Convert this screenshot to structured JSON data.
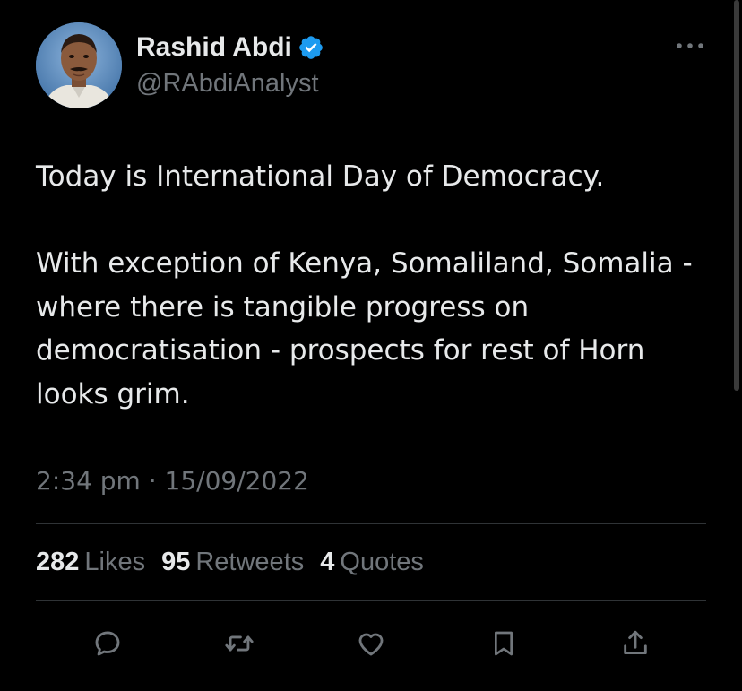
{
  "author": {
    "name": "Rashid Abdi",
    "handle": "@RAbdiAnalyst",
    "verified": true,
    "verified_color": "#1d9bf0"
  },
  "tweet": {
    "paragraphs": [
      "Today is International Day of Democracy.",
      "With exception of Kenya, Somaliland, Somalia - where there is tangible progress on democratisation - prospects for rest of Horn looks grim."
    ],
    "timestamp": "2:34 pm · 15/09/2022"
  },
  "stats": {
    "likes": {
      "count": "282",
      "label": "Likes"
    },
    "retweets": {
      "count": "95",
      "label": "Retweets"
    },
    "quotes": {
      "count": "4",
      "label": "Quotes"
    }
  },
  "actions": [
    {
      "icon": "reply-icon"
    },
    {
      "icon": "retweet-icon"
    },
    {
      "icon": "like-icon"
    },
    {
      "icon": "bookmark-icon"
    },
    {
      "icon": "share-icon"
    }
  ],
  "colors": {
    "background": "#000000",
    "primary_text": "#e7e9ea",
    "secondary_text": "#71767b",
    "divider": "#2f3336"
  }
}
